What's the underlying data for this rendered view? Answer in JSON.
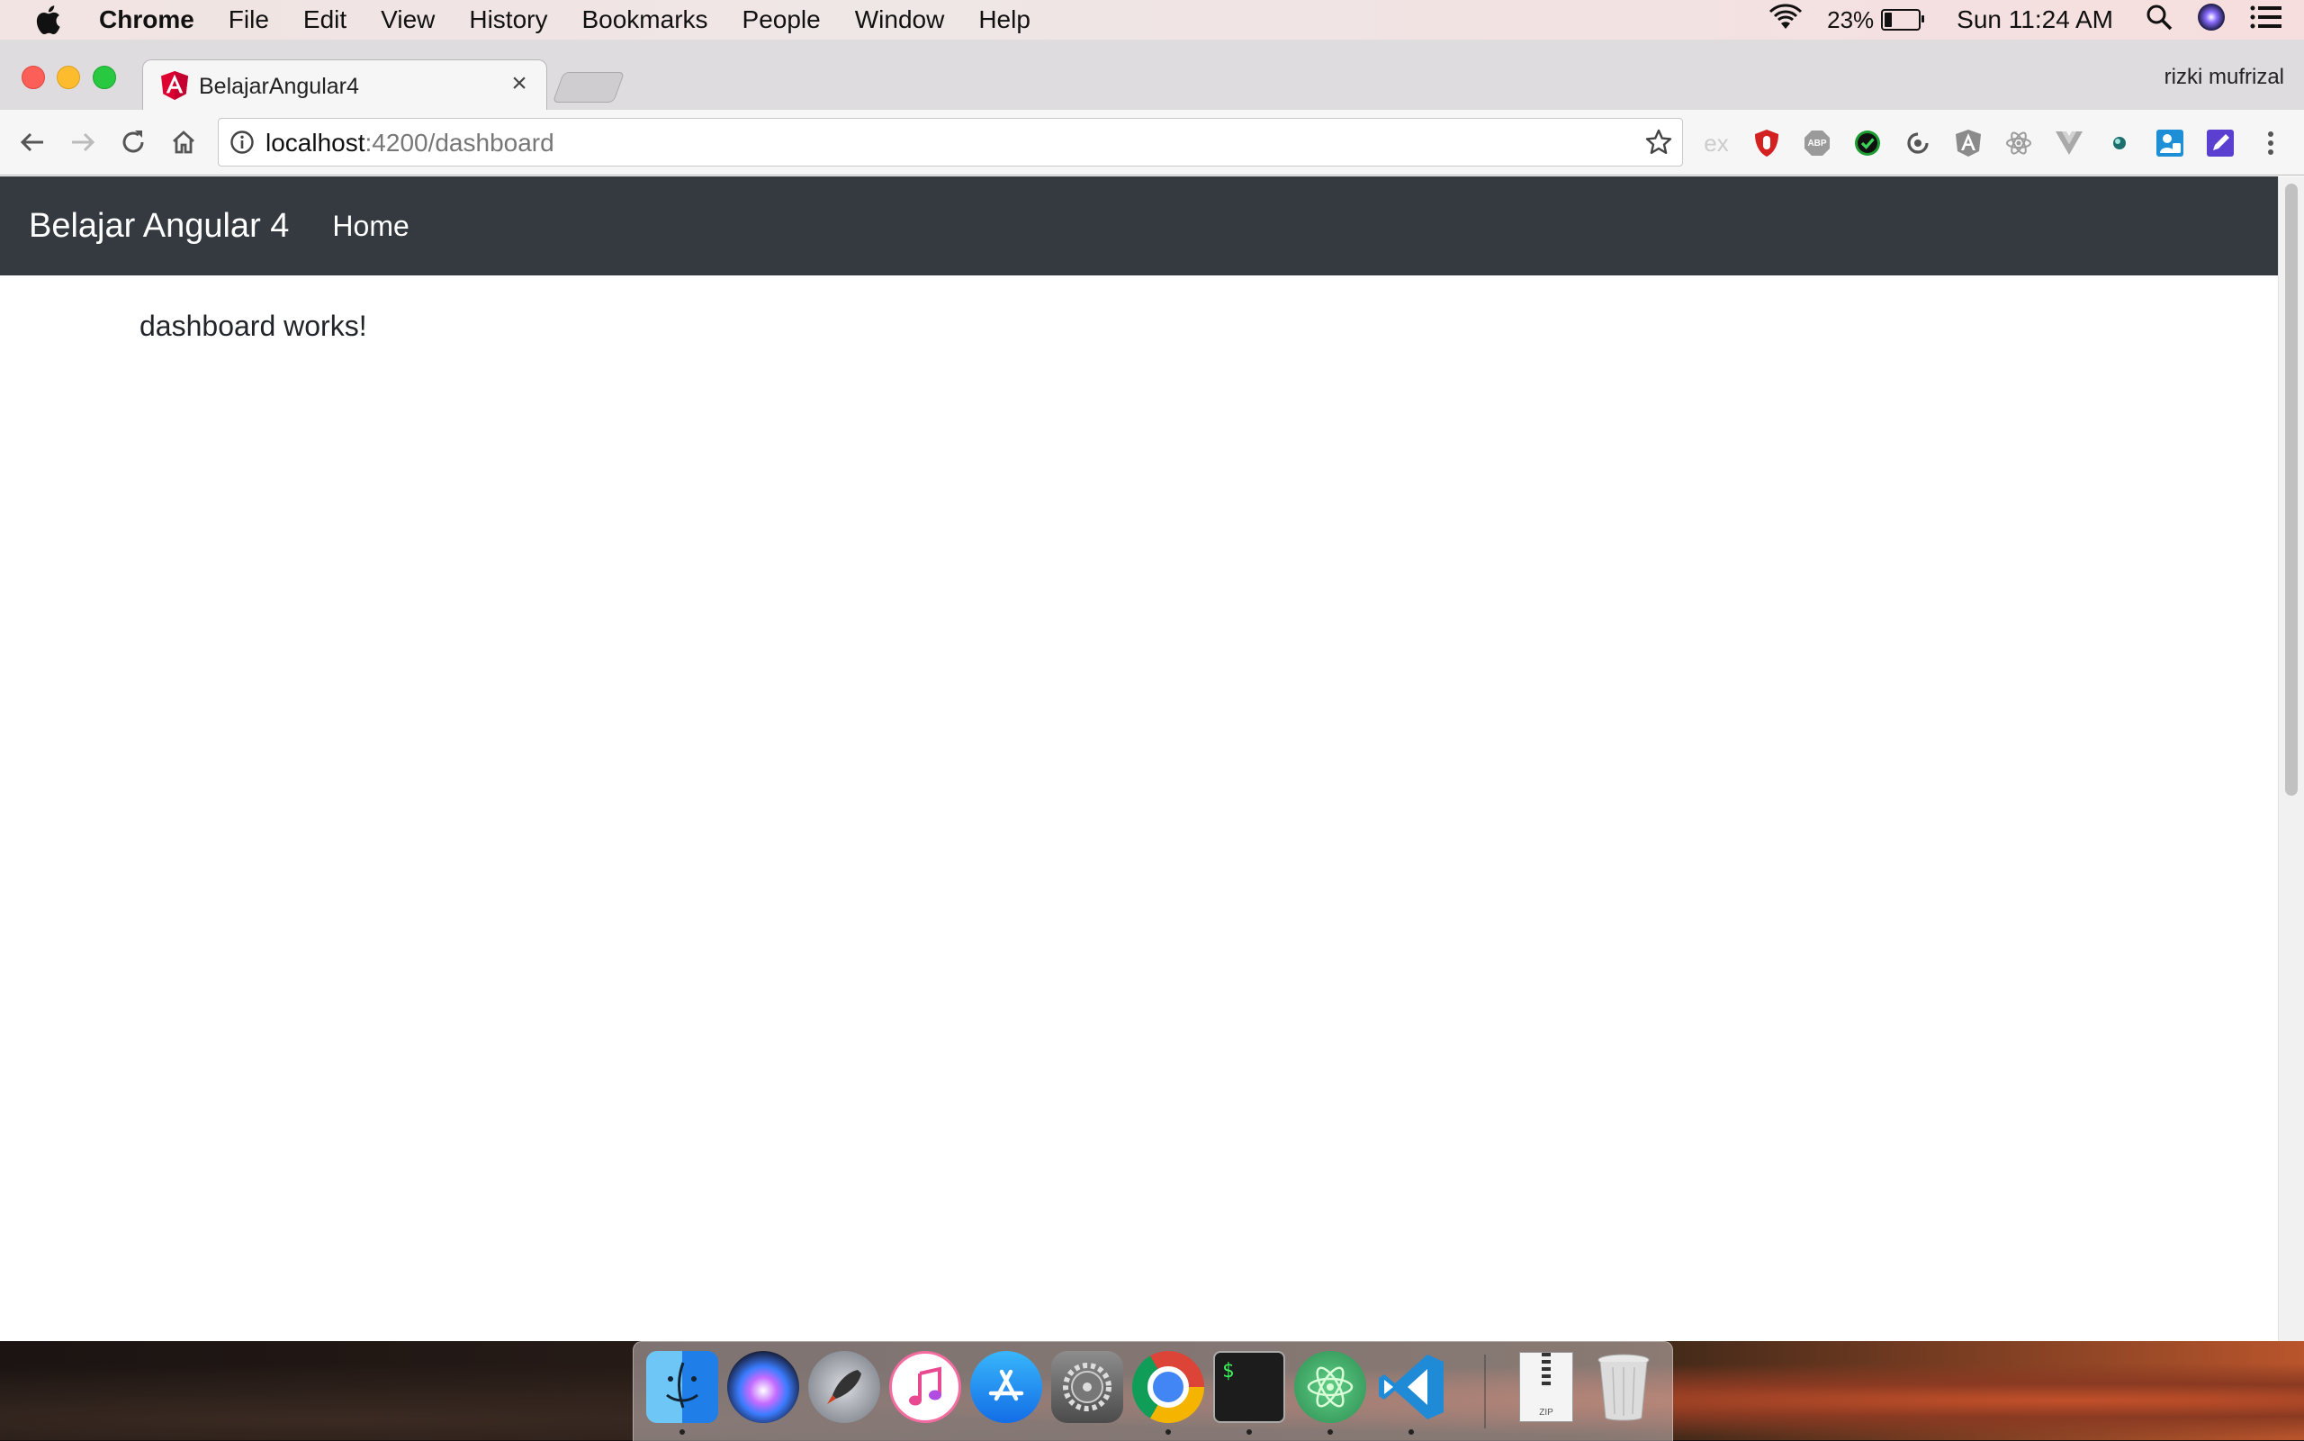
{
  "menubar": {
    "app_name": "Chrome",
    "items": [
      "File",
      "Edit",
      "View",
      "History",
      "Bookmarks",
      "People",
      "Window",
      "Help"
    ],
    "battery_percent": "23%",
    "battery_level": 0.23,
    "clock": "Sun 11:24 AM"
  },
  "browser": {
    "tab_title": "BelajarAngular4",
    "tab_close": "×",
    "profile_name": "rizki mufrizal",
    "url_host": "localhost",
    "url_path": ":4200/dashboard",
    "extensions": [
      "ex",
      "ublock-icon",
      "abp-icon",
      "check-icon",
      "sync-icon",
      "angular-ext-icon",
      "react-icon",
      "vue-icon",
      "dot-icon",
      "contact-icon",
      "pencil-icon"
    ],
    "abp_label": "ABP",
    "ex_label": "ex"
  },
  "page": {
    "brand": "Belajar Angular 4",
    "nav_home": "Home",
    "content": "dashboard works!",
    "navbar_color": "#343a40"
  },
  "dock": {
    "apps": [
      "finder",
      "siri",
      "launchpad",
      "itunes",
      "app-store",
      "system-preferences",
      "chrome",
      "terminal",
      "atom",
      "vscode",
      "zip-archive",
      "trash"
    ],
    "terminal_prompt": "$",
    "zip_label": "ZIP"
  }
}
